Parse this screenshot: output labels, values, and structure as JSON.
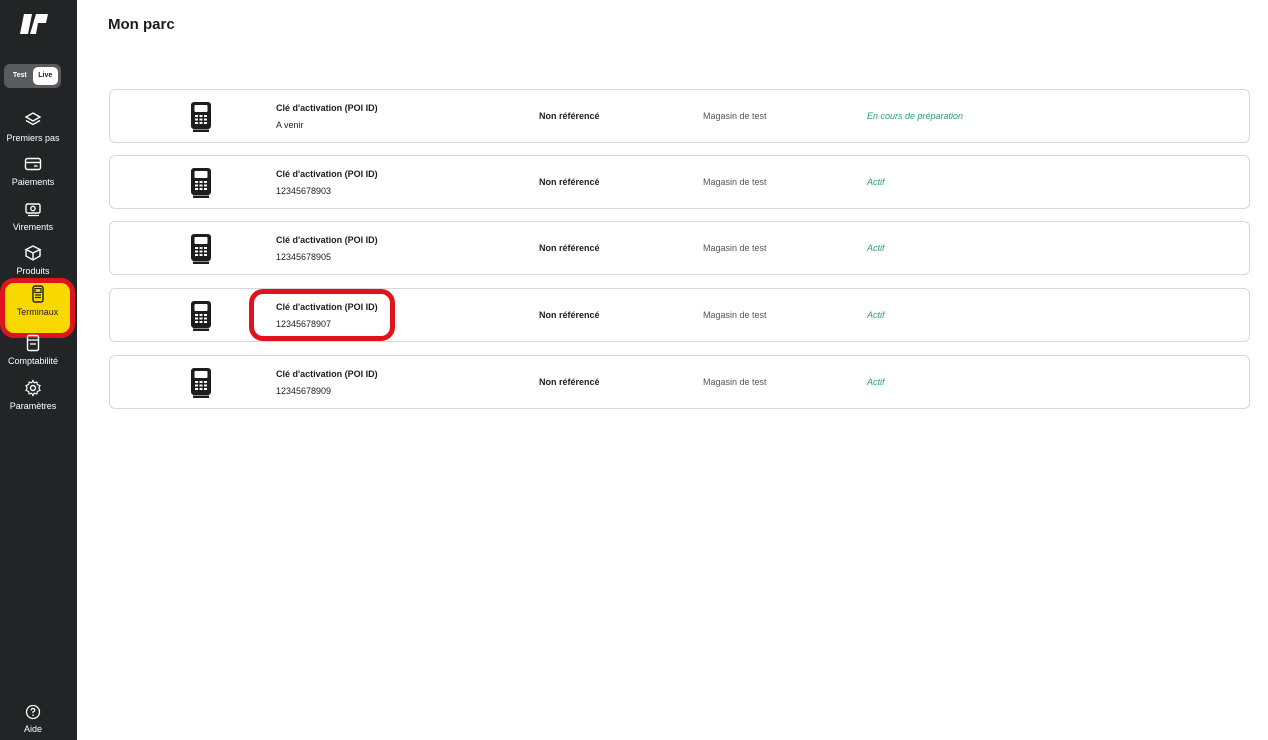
{
  "sidebar": {
    "env": {
      "test_label": "Test",
      "live_label": "Live",
      "selected": "Live"
    },
    "items": [
      {
        "label": "Premiers pas",
        "icon": "layers-icon"
      },
      {
        "label": "Paiements",
        "icon": "card-icon"
      },
      {
        "label": "Virements",
        "icon": "cash-icon"
      },
      {
        "label": "Produits",
        "icon": "box-icon"
      },
      {
        "label": "Terminaux",
        "icon": "terminal-icon",
        "active": true
      },
      {
        "label": "Comptabilité",
        "icon": "ledger-icon"
      },
      {
        "label": "Paramètres",
        "icon": "gear-icon"
      }
    ],
    "help_label": "Aide",
    "colors": {
      "background": "#232426",
      "active": "#f7d900",
      "highlight": "#e0131d"
    }
  },
  "main": {
    "title": "Mon parc",
    "terminals": [
      {
        "poi_label": "Clé d'activation (POI ID)",
        "poi_value": "A venir",
        "reference": "Non référencé",
        "store": "Magasin de test",
        "status": "En cours de préparation"
      },
      {
        "poi_label": "Clé d'activation (POI ID)",
        "poi_value": "12345678903",
        "reference": "Non référencé",
        "store": "Magasin de test",
        "status": "Actif"
      },
      {
        "poi_label": "Clé d'activation (POI ID)",
        "poi_value": "12345678905",
        "reference": "Non référencé",
        "store": "Magasin de test",
        "status": "Actif"
      },
      {
        "poi_label": "Clé d'activation (POI ID)",
        "poi_value": "12345678907",
        "reference": "Non référencé",
        "store": "Magasin de test",
        "status": "Actif",
        "highlighted": true
      },
      {
        "poi_label": "Clé d'activation (POI ID)",
        "poi_value": "12345678909",
        "reference": "Non référencé",
        "store": "Magasin de test",
        "status": "Actif"
      }
    ],
    "status_color": "#2aa06e"
  }
}
